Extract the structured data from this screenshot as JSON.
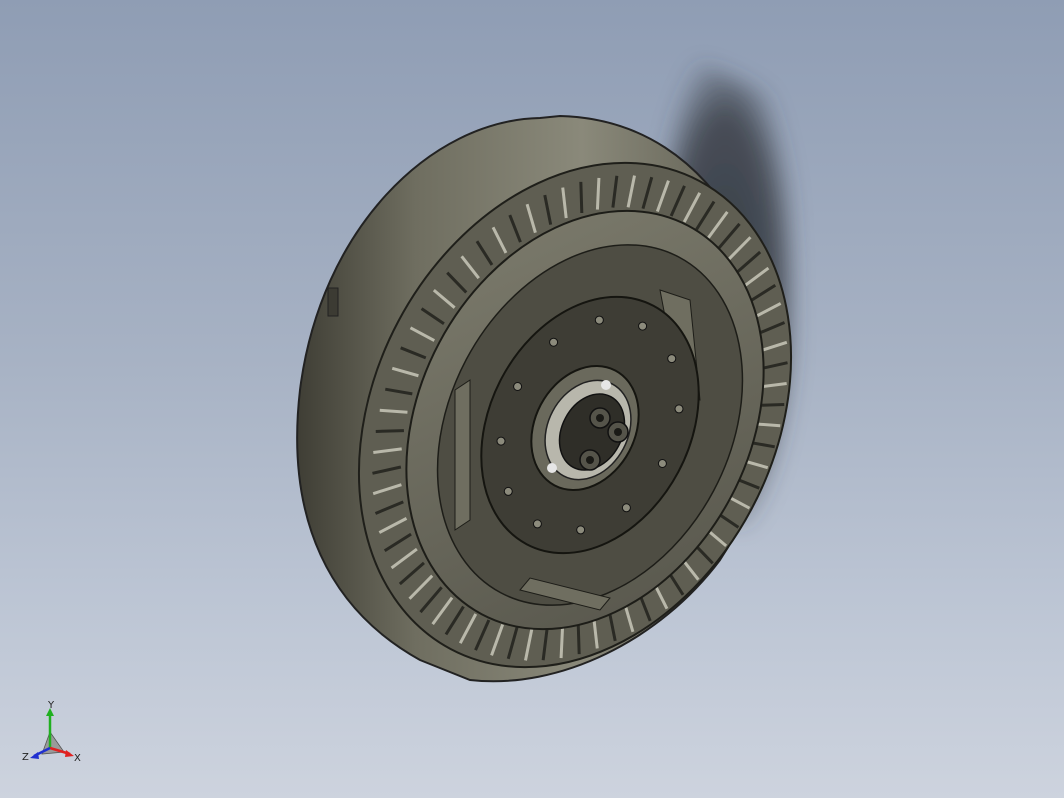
{
  "viewport": {
    "background_top": "#8f9db4",
    "background_bottom": "#cdd3de",
    "model_color": "#6b6a5c",
    "shadow_color": "#3a3f47"
  },
  "triad": {
    "x_label": "X",
    "y_label": "Y",
    "z_label": "Z",
    "x_color": "#e02020",
    "y_color": "#20b020",
    "z_color": "#2030d0"
  }
}
